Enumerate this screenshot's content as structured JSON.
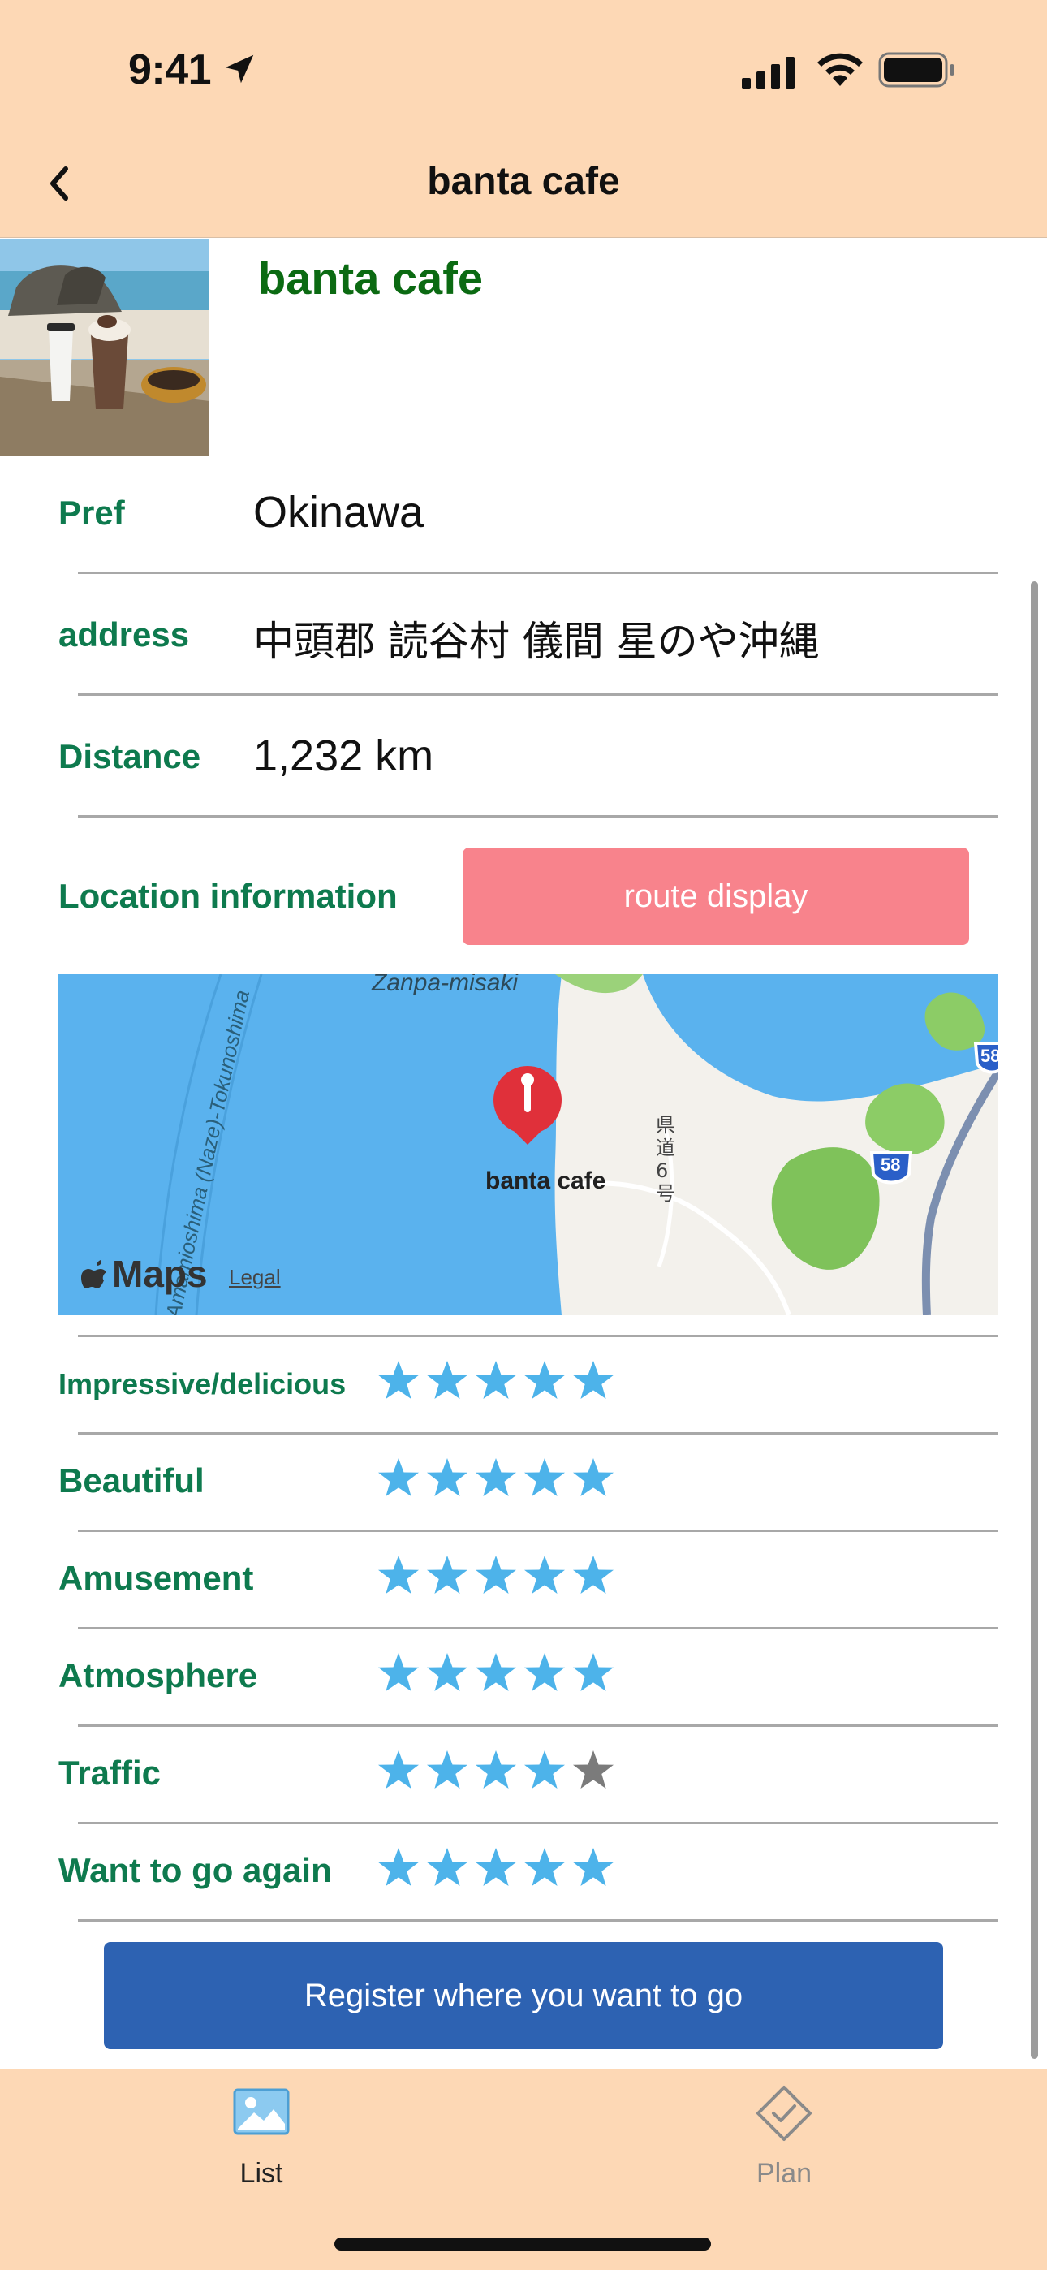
{
  "status_bar": {
    "time": "9:41"
  },
  "nav": {
    "title": "banta cafe",
    "back_icon": "chevron-left-icon"
  },
  "header": {
    "place_name": "banta cafe",
    "photo": "beach-cafe-photo"
  },
  "info": {
    "pref_label": "Pref",
    "pref_value": "Okinawa",
    "address_label": "address",
    "address_value": "中頭郡 読谷村 儀間 星のや沖縄",
    "distance_label": "Distance",
    "distance_value": "1,232 km",
    "location_label": "Location information",
    "route_button": "route display"
  },
  "map": {
    "pin_label": "banta cafe",
    "cape_label": "Zanpa-misaki",
    "channel_label": "Amamioshima (Naze)-Tokunoshima",
    "road_label": "県道6号",
    "route_58": "58",
    "maps_brand": "Maps",
    "legal": "Legal"
  },
  "ratings": [
    {
      "label": "Impressive/delicious",
      "stars": 5
    },
    {
      "label": "Beautiful",
      "stars": 5
    },
    {
      "label": "Amusement",
      "stars": 5
    },
    {
      "label": "Atmosphere",
      "stars": 5
    },
    {
      "label": "Traffic",
      "stars": 4
    },
    {
      "label": "Want to go again",
      "stars": 5
    }
  ],
  "register_button": "Register where you want to go",
  "tabs": [
    {
      "label": "List",
      "icon": "photo-icon",
      "active": true
    },
    {
      "label": "Plan",
      "icon": "diamond-check-icon",
      "active": false
    }
  ],
  "colors": {
    "bars": "#fdd8b5",
    "label_green": "#0e7a4e",
    "title_green": "#0b6a12",
    "route_btn": "#f8838c",
    "register_btn": "#2d62b2",
    "star_on": "#4db3ea",
    "star_off": "#7b7b7b"
  },
  "max_stars": 5
}
